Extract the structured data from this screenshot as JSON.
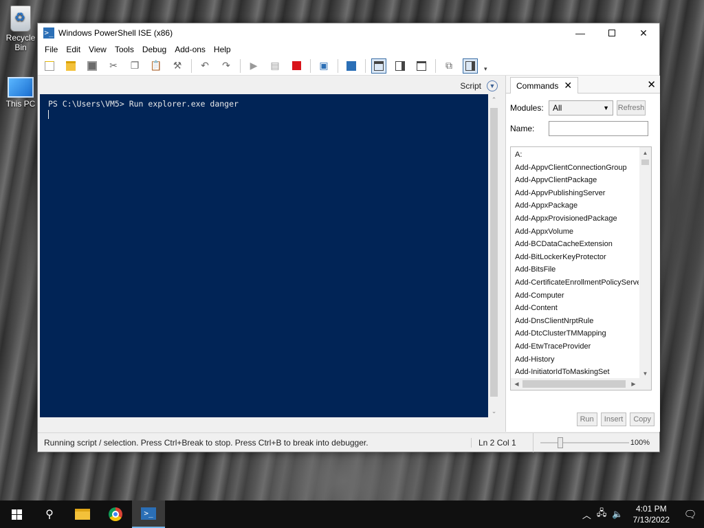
{
  "desktop": {
    "icons": [
      {
        "label": "Recycle Bin"
      },
      {
        "label": "This PC"
      }
    ]
  },
  "window": {
    "title": "Windows PowerShell ISE (x86)",
    "minimize_glyph": "—",
    "close_glyph": "✕"
  },
  "menu": [
    "File",
    "Edit",
    "View",
    "Tools",
    "Debug",
    "Add-ons",
    "Help"
  ],
  "toolbar": {
    "icons": [
      "new-icon",
      "open-icon",
      "save-icon",
      "cut-icon",
      "copy-icon",
      "paste-icon",
      "clear-icon",
      "undo-icon",
      "redo-icon",
      "run-icon",
      "run-selection-icon",
      "stop-icon",
      "remote-icon",
      "powershell-tab-icon",
      "layout-top-icon",
      "layout-right-icon",
      "layout-max-icon",
      "show-script-icon",
      "show-commands-icon"
    ],
    "overflow_glyph": "▾"
  },
  "script_bar": {
    "label": "Script"
  },
  "console": {
    "prompt_line": "PS C:\\Users\\VM5> Run explorer.exe danger"
  },
  "commands": {
    "tab_label": "Commands",
    "modules_label": "Modules:",
    "modules_value": "All",
    "refresh_label": "Refresh",
    "name_label": "Name:",
    "name_value": "",
    "items": [
      "A:",
      "Add-AppvClientConnectionGroup",
      "Add-AppvClientPackage",
      "Add-AppvPublishingServer",
      "Add-AppxPackage",
      "Add-AppxProvisionedPackage",
      "Add-AppxVolume",
      "Add-BCDataCacheExtension",
      "Add-BitLockerKeyProtector",
      "Add-BitsFile",
      "Add-CertificateEnrollmentPolicyServer",
      "Add-Computer",
      "Add-Content",
      "Add-DnsClientNrptRule",
      "Add-DtcClusterTMMapping",
      "Add-EtwTraceProvider",
      "Add-History",
      "Add-InitiatorIdToMaskingSet"
    ],
    "run_label": "Run",
    "insert_label": "Insert",
    "copy_label": "Copy"
  },
  "status": {
    "message": "Running script / selection.  Press Ctrl+Break to stop.  Press Ctrl+B to break into debugger.",
    "position": "Ln 2  Col 1",
    "zoom": "100%",
    "zoom_fraction": 0.2
  },
  "taskbar": {
    "time": "4:01 PM",
    "date": "7/13/2022"
  },
  "colors": {
    "console_bg": "#012456",
    "console_fg": "#eaeaea",
    "taskbar_bg": "#101010",
    "accent": "#2b6fb6"
  }
}
